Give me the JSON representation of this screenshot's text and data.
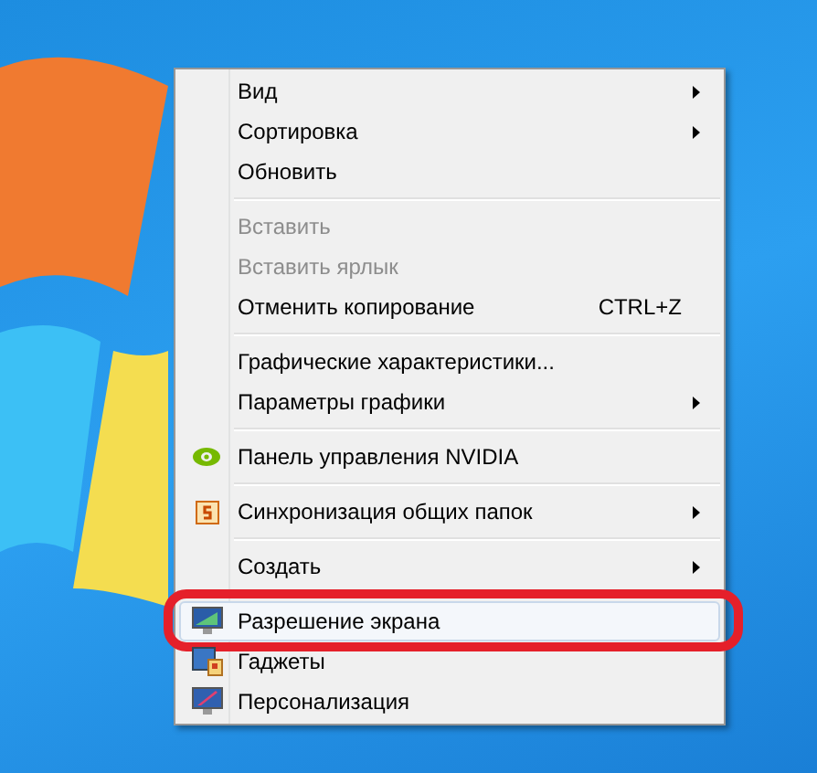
{
  "context_menu": {
    "groups": [
      {
        "items": [
          {
            "kind": "text",
            "label": "Вид",
            "submenu": true,
            "disabled": false,
            "highlighted": false,
            "circled": false
          },
          {
            "kind": "text",
            "label": "Сортировка",
            "submenu": true,
            "disabled": false,
            "highlighted": false,
            "circled": false
          },
          {
            "kind": "text",
            "label": "Обновить",
            "submenu": false,
            "disabled": false,
            "highlighted": false,
            "circled": false
          }
        ]
      },
      {
        "items": [
          {
            "kind": "text",
            "label": "Вставить",
            "submenu": false,
            "disabled": true,
            "highlighted": false,
            "circled": false
          },
          {
            "kind": "text",
            "label": "Вставить ярлык",
            "submenu": false,
            "disabled": true,
            "highlighted": false,
            "circled": false
          },
          {
            "kind": "text",
            "label": "Отменить копирование",
            "shortcut": "CTRL+Z",
            "submenu": false,
            "disabled": false,
            "highlighted": false,
            "circled": false
          }
        ]
      },
      {
        "items": [
          {
            "kind": "text",
            "label": "Графические характеристики...",
            "submenu": false,
            "disabled": false,
            "highlighted": false,
            "circled": false
          },
          {
            "kind": "text",
            "label": "Параметры графики",
            "submenu": true,
            "disabled": false,
            "highlighted": false,
            "circled": false
          }
        ]
      },
      {
        "items": [
          {
            "kind": "nvidia",
            "label": "Панель управления NVIDIA",
            "submenu": false,
            "disabled": false,
            "highlighted": false,
            "circled": false
          }
        ]
      },
      {
        "items": [
          {
            "kind": "sync",
            "label": "Синхронизация общих папок",
            "submenu": true,
            "disabled": false,
            "highlighted": false,
            "circled": false
          }
        ]
      },
      {
        "items": [
          {
            "kind": "text",
            "label": "Создать",
            "submenu": true,
            "disabled": false,
            "highlighted": false,
            "circled": false
          }
        ]
      },
      {
        "items": [
          {
            "kind": "display",
            "label": "Разрешение экрана",
            "submenu": false,
            "disabled": false,
            "highlighted": true,
            "circled": true
          },
          {
            "kind": "gadgets",
            "label": "Гаджеты",
            "submenu": false,
            "disabled": false,
            "highlighted": false,
            "circled": false
          },
          {
            "kind": "personalize",
            "label": "Персонализация",
            "submenu": false,
            "disabled": false,
            "highlighted": false,
            "circled": false
          }
        ]
      }
    ]
  }
}
